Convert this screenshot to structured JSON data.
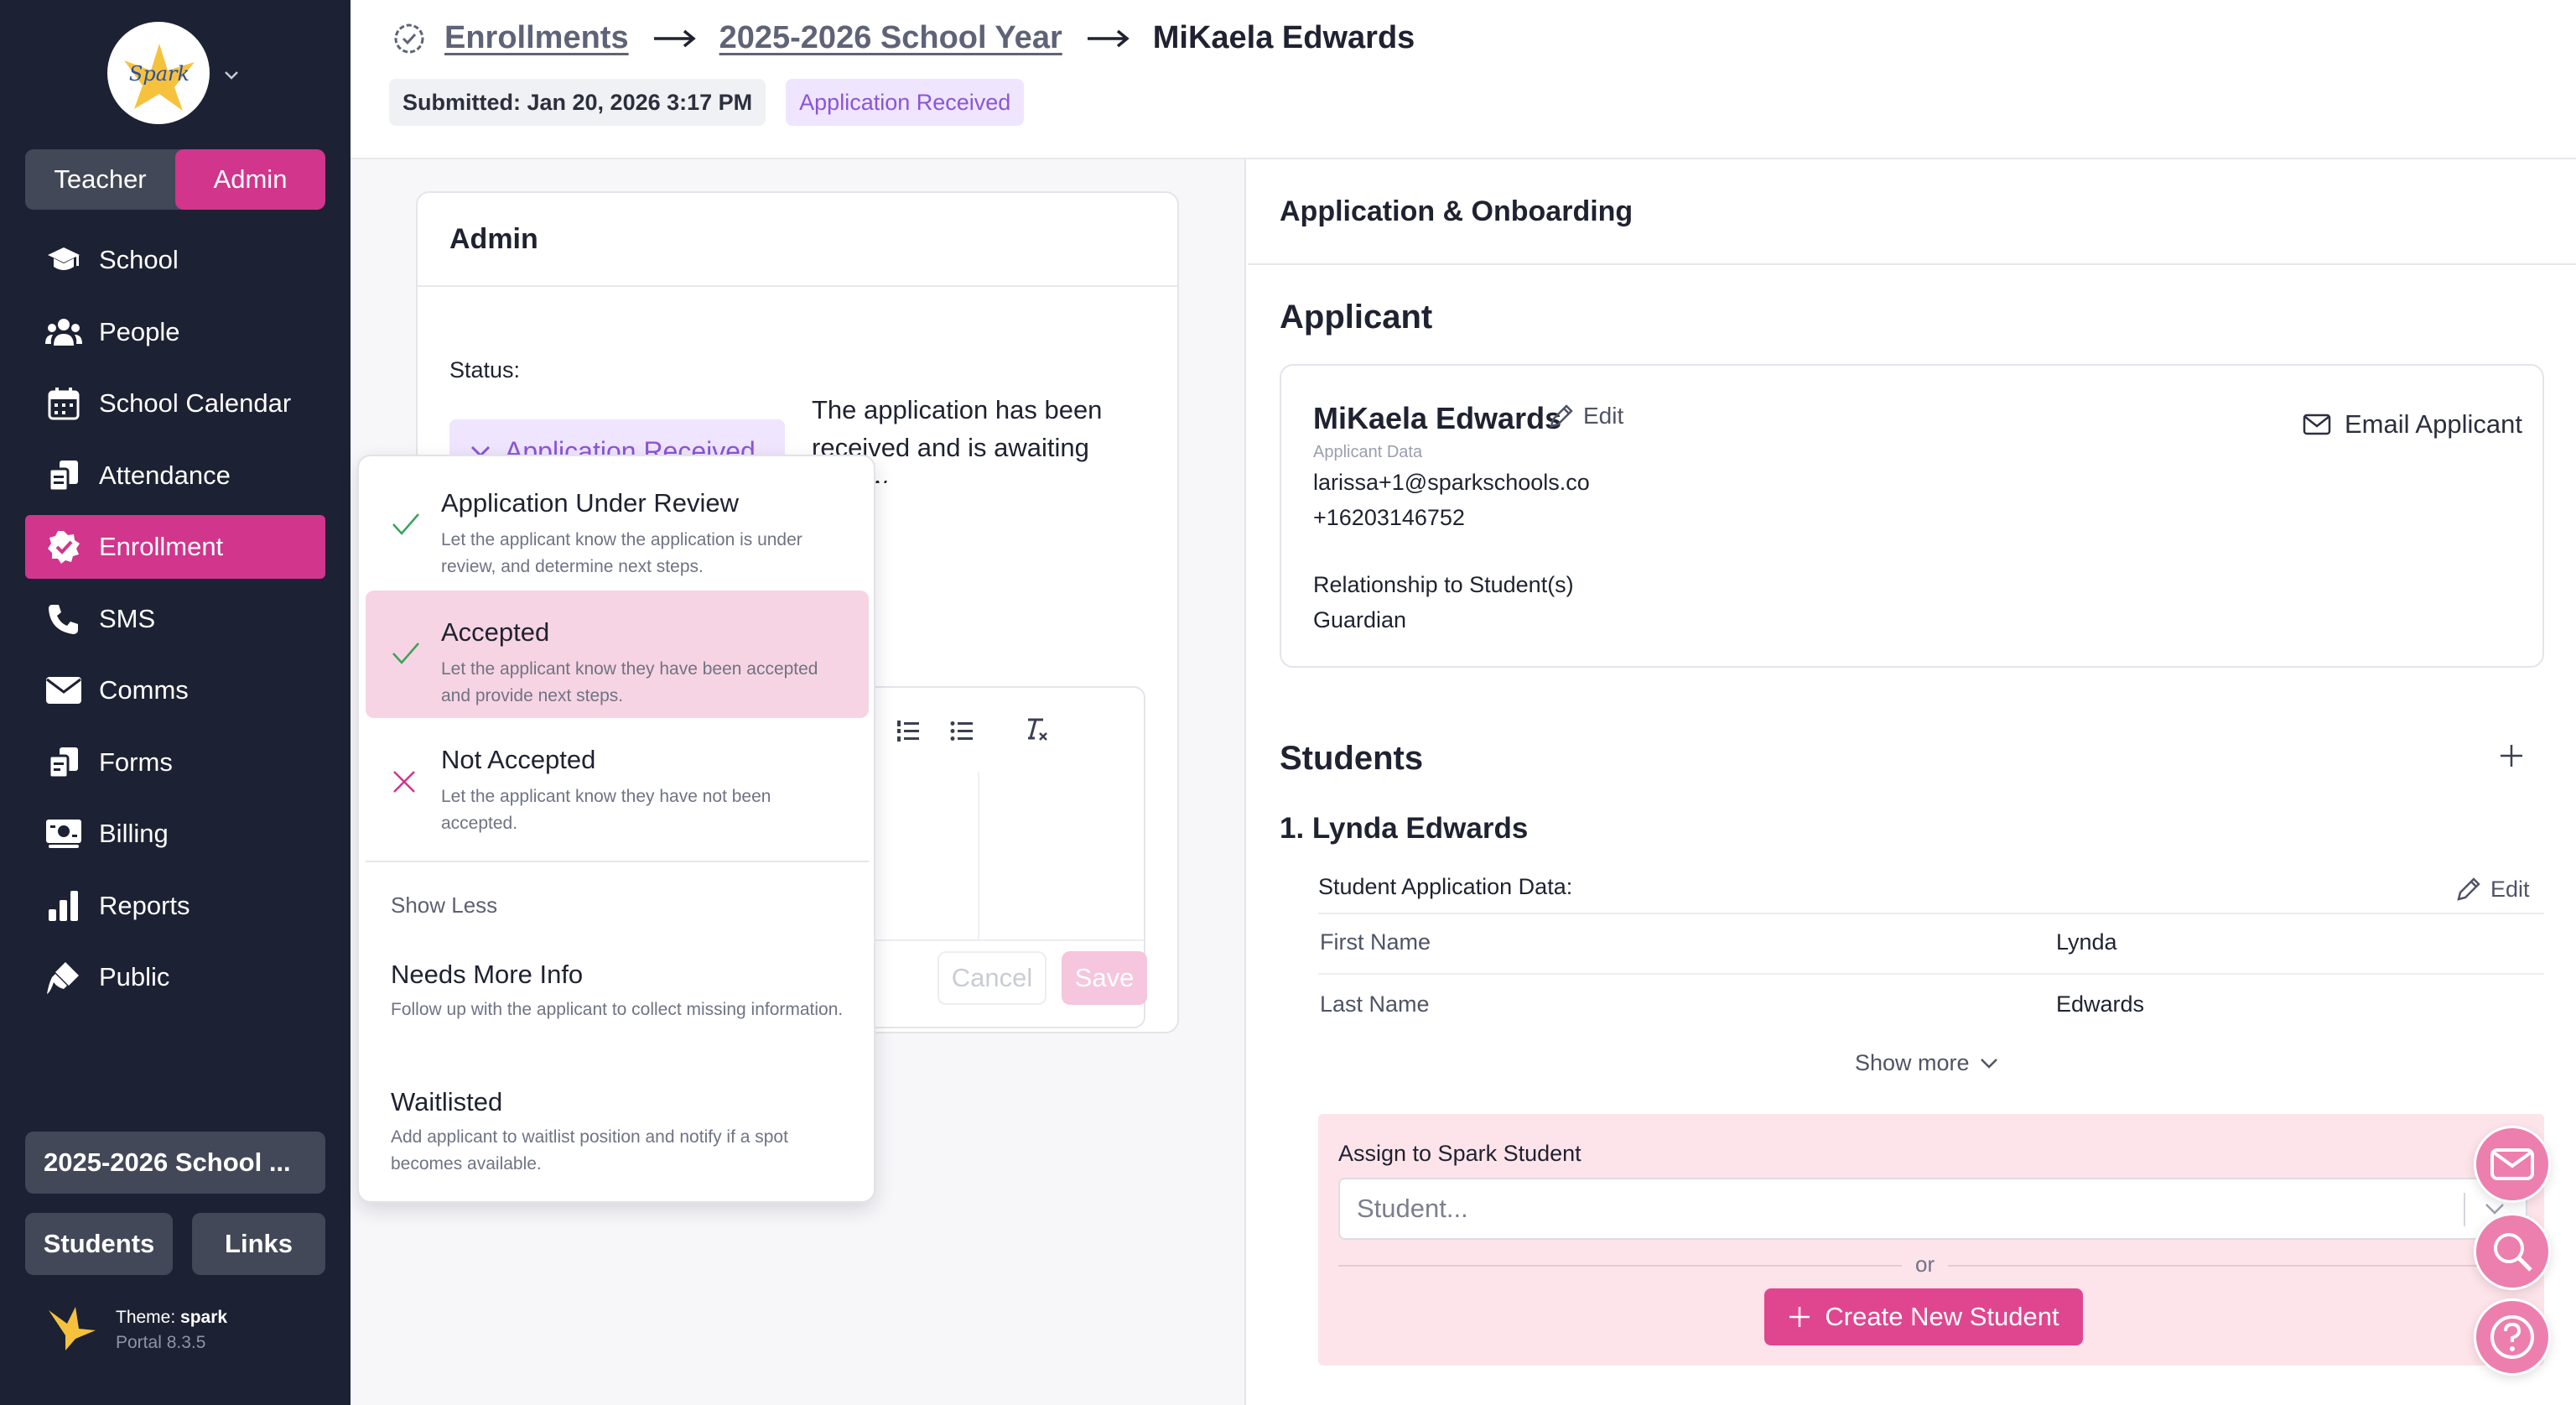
{
  "sidebar": {
    "logo_text": "Spark",
    "roles": [
      "Teacher",
      "Admin"
    ],
    "active_role": "Admin",
    "items": [
      {
        "label": "School",
        "icon": "graduation-cap-icon"
      },
      {
        "label": "People",
        "icon": "people-icon"
      },
      {
        "label": "School Calendar",
        "icon": "calendar-icon"
      },
      {
        "label": "Attendance",
        "icon": "clipboard-icon"
      },
      {
        "label": "Enrollment",
        "icon": "check-badge-icon",
        "active": true
      },
      {
        "label": "SMS",
        "icon": "phone-icon"
      },
      {
        "label": "Comms",
        "icon": "envelope-icon"
      },
      {
        "label": "Forms",
        "icon": "forms-icon"
      },
      {
        "label": "Billing",
        "icon": "billing-icon"
      },
      {
        "label": "Reports",
        "icon": "bar-chart-icon"
      },
      {
        "label": "Public",
        "icon": "brush-icon"
      }
    ],
    "school_year": "2025-2026 School ...",
    "students_btn": "Students",
    "links_btn": "Links",
    "theme_label": "Theme:",
    "theme_name": "spark",
    "portal_version": "Portal 8.3.5"
  },
  "header": {
    "crumbs": [
      "Enrollments",
      "2025-2026 School Year"
    ],
    "current": "MiKaela Edwards",
    "submitted": "Submitted: Jan 20, 2026 3:17 PM",
    "status_chip": "Application Received"
  },
  "admin": {
    "title": "Admin",
    "status_label": "Status:",
    "status_value": "Application Received",
    "status_desc": "The application has been received and is awaiting review.",
    "cancel": "Cancel",
    "save": "Save"
  },
  "dropdown": {
    "items": [
      {
        "title": "Application Under Review",
        "desc": "Let the applicant know the application is under review, and determine next steps."
      },
      {
        "title": "Accepted",
        "desc": "Let the applicant know they have been accepted and provide next steps."
      },
      {
        "title": "Not Accepted",
        "desc": "Let the applicant know they have not been accepted."
      }
    ],
    "show_less": "Show Less",
    "extra": [
      {
        "title": "Needs More Info",
        "desc": "Follow up with the applicant to collect missing information."
      },
      {
        "title": "Waitlisted",
        "desc": "Add applicant to waitlist position and notify if a spot becomes available."
      }
    ]
  },
  "right": {
    "title": "Application & Onboarding",
    "applicant_heading": "Applicant",
    "applicant": {
      "name": "MiKaela Edwards",
      "edit": "Edit",
      "sub": "Applicant Data",
      "email": "larissa+1@sparkschools.co",
      "phone": "+16203146752",
      "rel_label": "Relationship to Student(s)",
      "rel_value": "Guardian",
      "email_btn": "Email Applicant"
    },
    "students_heading": "Students",
    "student": {
      "name": "1.  Lynda Edwards",
      "app_data": "Student Application Data:",
      "edit": "Edit",
      "rows": [
        {
          "label": "First Name",
          "value": "Lynda"
        },
        {
          "label": "Last Name",
          "value": "Edwards"
        }
      ],
      "show_more": "Show more"
    },
    "assign": {
      "label": "Assign to Spark Student",
      "placeholder": "Student...",
      "or": "or",
      "create": "Create New Student"
    }
  },
  "colors": {
    "sidebar_bg": "#1c2133",
    "accent": "#d1358c",
    "purple": "#8a55d6"
  }
}
